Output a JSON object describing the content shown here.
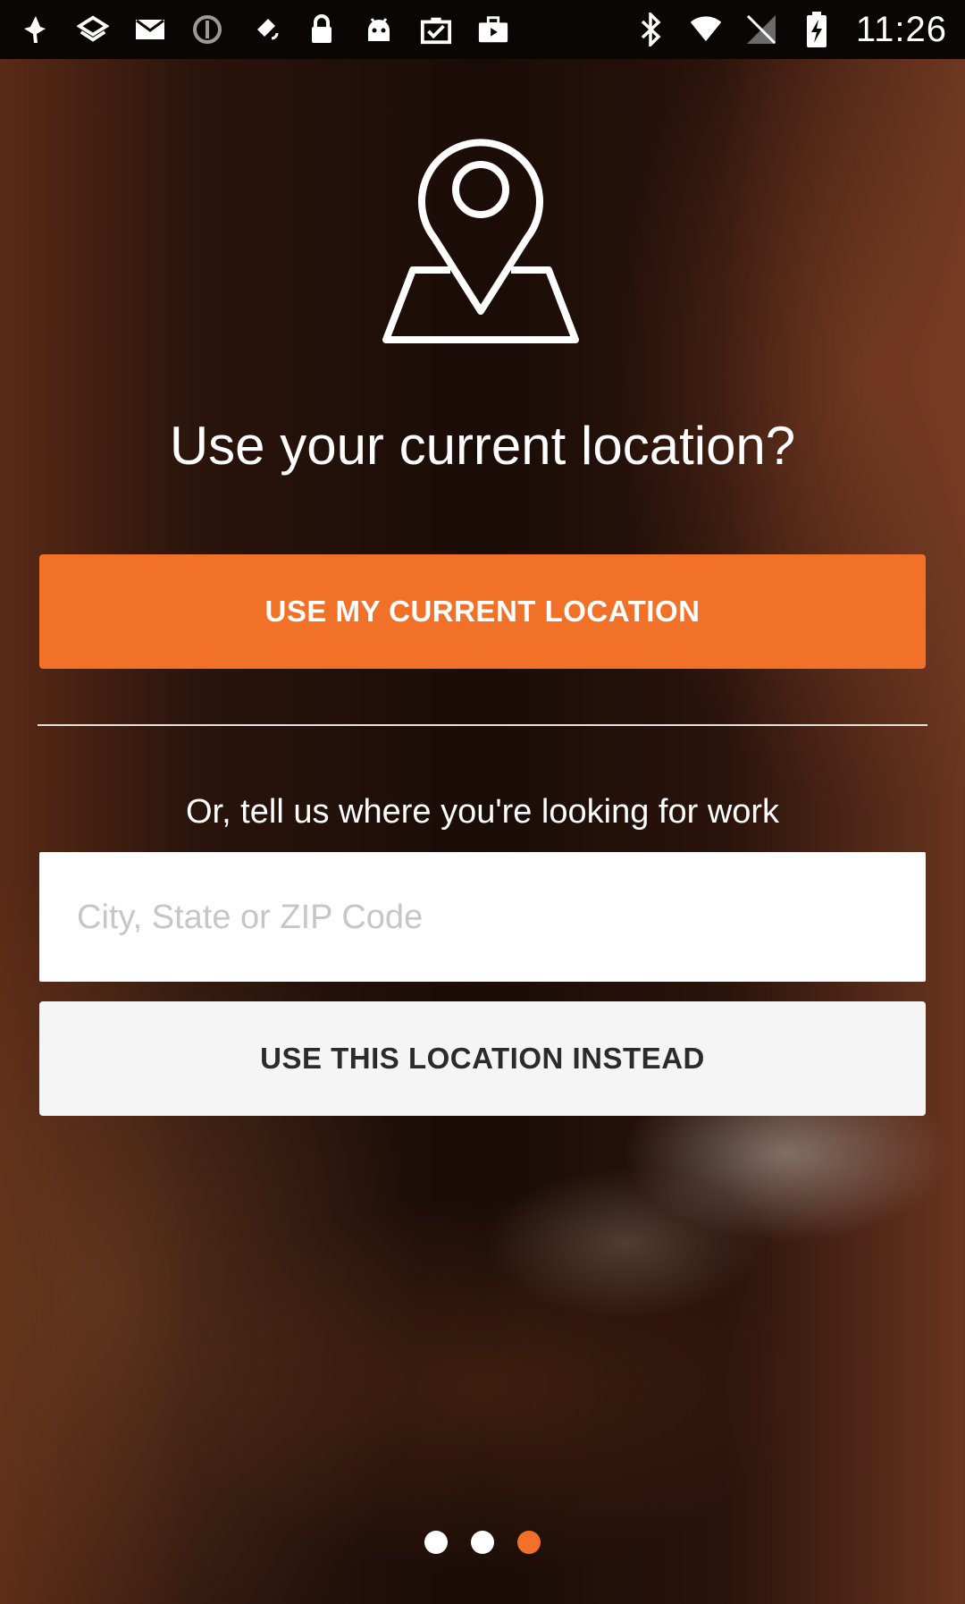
{
  "status_bar": {
    "left_icons": [
      "notification-icon",
      "layers-icon",
      "mail-icon",
      "block-icon",
      "satellite-icon",
      "lock-icon",
      "android-icon",
      "task-check-icon",
      "briefcase-icon"
    ],
    "right_icons": [
      "bluetooth-icon",
      "wifi-icon",
      "no-sim-icon",
      "battery-charging-icon"
    ],
    "time": "11:26"
  },
  "hero": {
    "icon": "map-pin-icon"
  },
  "prompt": {
    "title": "Use your current location?"
  },
  "primary_button": {
    "label": "USE MY CURRENT LOCATION"
  },
  "alternate": {
    "subtitle": "Or, tell us where you're looking for work",
    "input_placeholder": "City, State or ZIP Code",
    "input_value": ""
  },
  "secondary_button": {
    "label": "USE THIS LOCATION INSTEAD"
  },
  "pager": {
    "total": 3,
    "active_index": 2
  },
  "colors": {
    "accent": "#f07127",
    "secondary_button": "#f5f5f5"
  }
}
